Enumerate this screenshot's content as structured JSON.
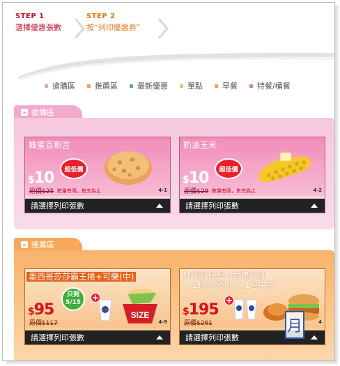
{
  "steps": [
    {
      "num": "STEP 1",
      "text": "選擇優惠張數"
    },
    {
      "num": "STEP 2",
      "text": "按“列印優惠券”"
    }
  ],
  "nav": [
    {
      "label": "搶購區",
      "color": "#e6a0c4"
    },
    {
      "label": "推薦區",
      "color": "#f3a455"
    },
    {
      "label": "最新優惠",
      "color": "#6f97c9"
    },
    {
      "label": "單點",
      "color": "#b7d46c"
    },
    {
      "label": "早餐",
      "color": "#f5a35a"
    },
    {
      "label": "特餐/桶餐",
      "color": "#d27fb0"
    }
  ],
  "sections": {
    "flash": {
      "label": "搶購區",
      "cards": [
        {
          "title": "蜂蜜百斯吉",
          "badge": "超低價",
          "price": "10",
          "orig": "原價$25",
          "note": "數量有限，售完為止",
          "code": "4-1",
          "select_label": "請選擇列印張數",
          "food": "biscuit-image"
        },
        {
          "title": "奶油玉米",
          "badge": "超低價",
          "price": "10",
          "orig": "原價$29",
          "note": "數量有限，售完為止",
          "code": "4-2",
          "select_label": "請選擇列印張數",
          "food": "corn-image"
        }
      ]
    },
    "recommend": {
      "label": "推薦區",
      "cards": [
        {
          "title": "墨西哥莎莎霸王捲+可樂(中)",
          "badge_line1": "只到",
          "badge_line2": "5/15",
          "price": "95",
          "orig": "原價$117",
          "code": "4-9",
          "select_label": "請選擇列印張數",
          "food": "wrap-combo-image"
        },
        {
          "title": "咔啦雞腿堡+兩塊炸雞",
          "title2": "+2杯可樂(小)+1包中薯",
          "price": "195",
          "orig": "原價$261",
          "code": "4",
          "select_label": "請選擇列印張數",
          "food": "burger-combo-image"
        }
      ]
    }
  },
  "float_icon": "月",
  "colors": {
    "step1": "#c8102e",
    "step2": "#e07b1a",
    "pink": "#f3a9c9",
    "orange": "#f7a85a"
  }
}
